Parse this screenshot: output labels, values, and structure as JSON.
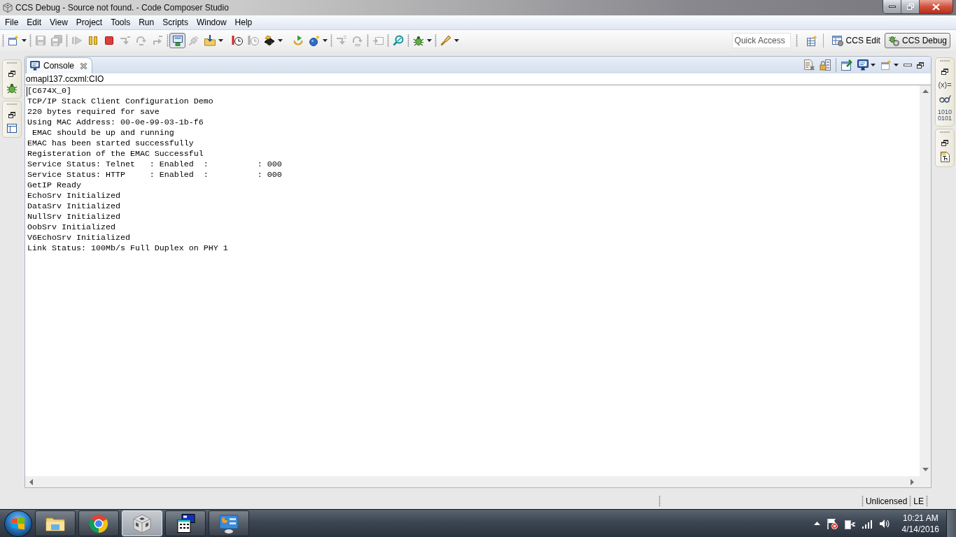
{
  "window": {
    "title": "CCS Debug - Source not found. - Code Composer Studio"
  },
  "menu_bar": [
    "File",
    "Edit",
    "View",
    "Project",
    "Tools",
    "Run",
    "Scripts",
    "Window",
    "Help"
  ],
  "toolbar": {
    "buttons": [
      {
        "disabled": false,
        "pressed": false
      },
      {
        "disabled": true,
        "pressed": false
      },
      {
        "disabled": true,
        "pressed": false
      },
      {
        "disabled": true,
        "pressed": false
      },
      {
        "disabled": false,
        "pressed": false
      },
      {
        "disabled": false,
        "pressed": false
      },
      {
        "disabled": true,
        "pressed": false
      },
      {
        "disabled": true,
        "pressed": false
      },
      {
        "disabled": true,
        "pressed": false
      },
      {
        "disabled": false,
        "pressed": true
      },
      {
        "disabled": true,
        "pressed": false
      },
      {
        "disabled": false,
        "pressed": false
      },
      {
        "disabled": false,
        "pressed": false
      },
      {
        "disabled": true,
        "pressed": false
      },
      {
        "disabled": false,
        "pressed": false
      },
      {
        "disabled": false,
        "pressed": false
      },
      {
        "disabled": false,
        "pressed": false
      },
      {
        "disabled": true,
        "pressed": false
      },
      {
        "disabled": true,
        "pressed": false
      },
      {
        "disabled": true,
        "pressed": false
      },
      {
        "disabled": false,
        "pressed": false
      },
      {
        "disabled": false,
        "pressed": false
      },
      {
        "disabled": false,
        "pressed": false
      }
    ],
    "quick_access": {
      "placeholder": "Quick Access"
    },
    "perspectives": [
      {
        "label": "CCS Edit",
        "selected": false
      },
      {
        "label": "CCS Debug",
        "selected": true
      }
    ]
  },
  "console": {
    "tab": {
      "label": "Console"
    },
    "source": "omapl137.ccxml:CIO",
    "lines": [
      "[C674X_0]",
      "TCP/IP Stack Client Configuration Demo",
      "220 bytes required for save",
      "Using MAC Address: 00-0e-99-03-1b-f6",
      " EMAC should be up and running",
      "EMAC has been started successfully",
      "Registeration of the EMAC Successful",
      "Service Status: Telnet   : Enabled  :          : 000",
      "Service Status: HTTP     : Enabled  :          : 000",
      "GetIP Ready",
      "EchoSrv Initialized",
      "DataSrv Initialized",
      "NullSrv Initialized",
      "OobSrv Initialized",
      "V6EchoSrv Initialized",
      "Link Status: 100Mb/s Full Duplex on PHY 1"
    ]
  },
  "right_trim": {
    "icon_texts": [
      "(x)=",
      "1010",
      "0101"
    ]
  },
  "status_bar": {
    "items": [
      "Unlicensed",
      "LE"
    ]
  },
  "taskbar": {
    "apps": [
      {
        "selected": false
      },
      {
        "selected": false
      },
      {
        "selected": true
      },
      {
        "selected": false
      },
      {
        "selected": false
      }
    ],
    "clock": {
      "time": "10:21 AM",
      "date": "4/14/2016"
    }
  }
}
